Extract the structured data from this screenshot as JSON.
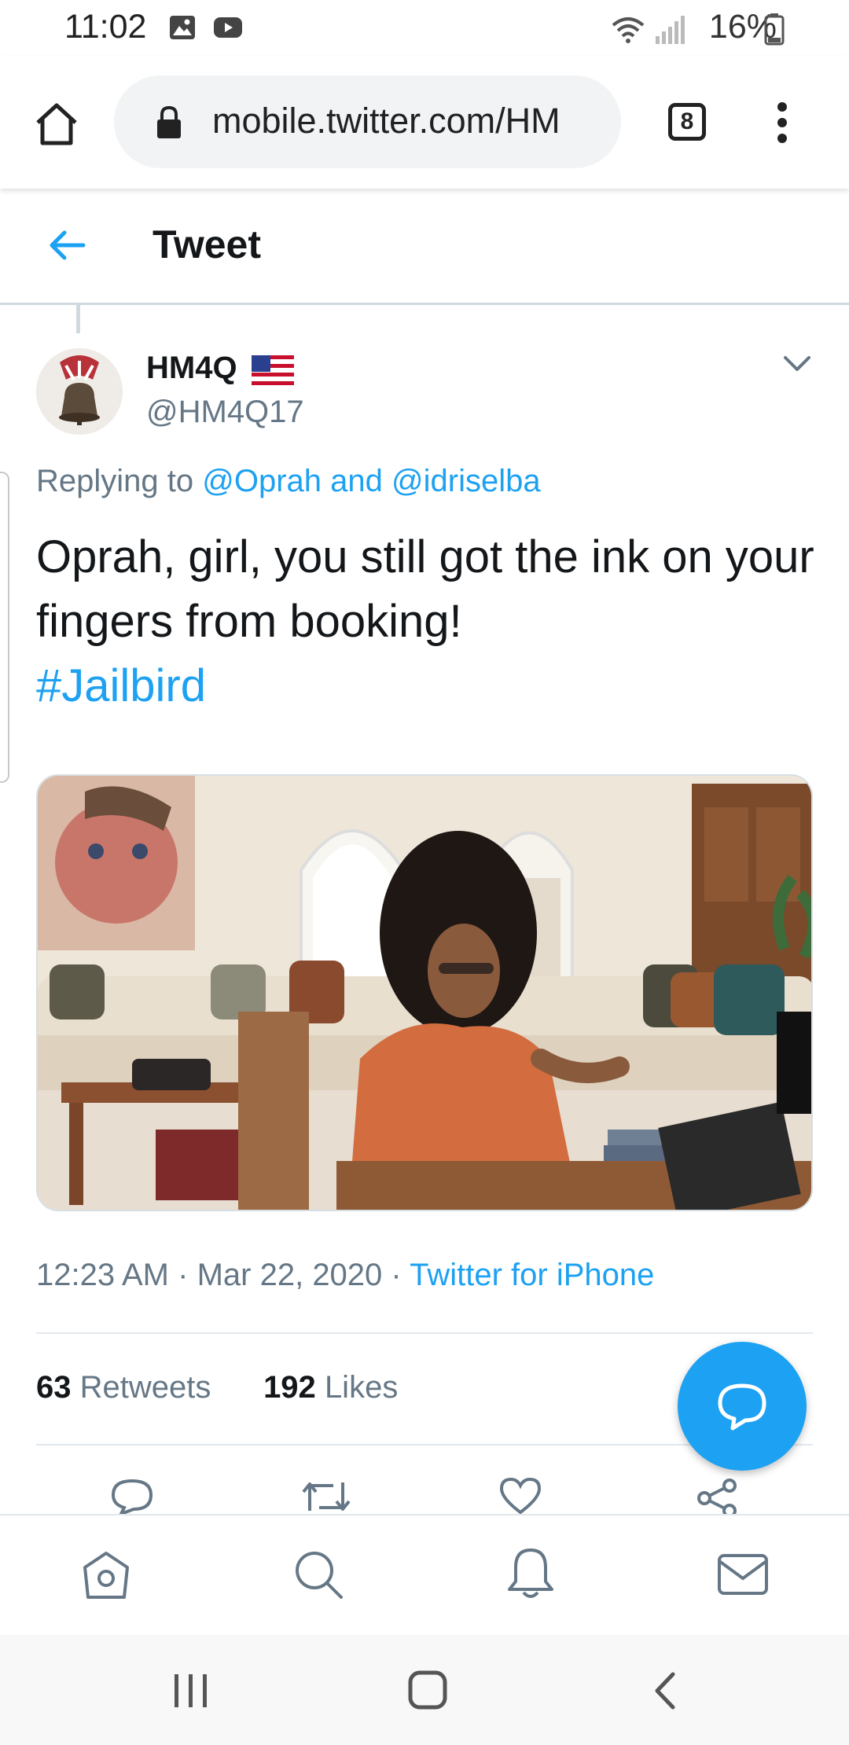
{
  "status_bar": {
    "time": "11:02",
    "battery_percent": "16%",
    "icons": [
      "image-notification-icon",
      "youtube-notification-icon",
      "wifi-icon",
      "signal-icon",
      "battery-icon"
    ]
  },
  "browser": {
    "url": "mobile.twitter.com/HM",
    "tab_count": "8",
    "icons": [
      "home-icon",
      "lock-icon",
      "tabs-icon",
      "overflow-menu-icon"
    ]
  },
  "header": {
    "title": "Tweet",
    "back_icon": "back-arrow-icon"
  },
  "tweet": {
    "display_name": "HM4Q",
    "flag": "us-flag",
    "handle": "@HM4Q17",
    "replying_prefix": "Replying to",
    "reply_to_1": "@Oprah",
    "reply_and": "and",
    "reply_to_2": "@idriselba",
    "text": "Oprah, girl, you still got the ink on your fingers from booking!",
    "hashtag": "#Jailbird",
    "time": "12:23 AM",
    "date": "Mar 22, 2020",
    "source": "Twitter for iPhone",
    "separator": "·",
    "retweets_count": "63",
    "retweets_label": "Retweets",
    "likes_count": "192",
    "likes_label": "Likes"
  },
  "actions": [
    "reply-icon",
    "retweet-icon",
    "like-icon",
    "share-icon"
  ],
  "bottom_nav": [
    "home-icon",
    "search-icon",
    "notifications-icon",
    "messages-icon"
  ],
  "colors": {
    "accent": "#1da1f2",
    "secondary_text": "#657786",
    "primary_text": "#14171a",
    "divider": "#e1e8ed"
  }
}
